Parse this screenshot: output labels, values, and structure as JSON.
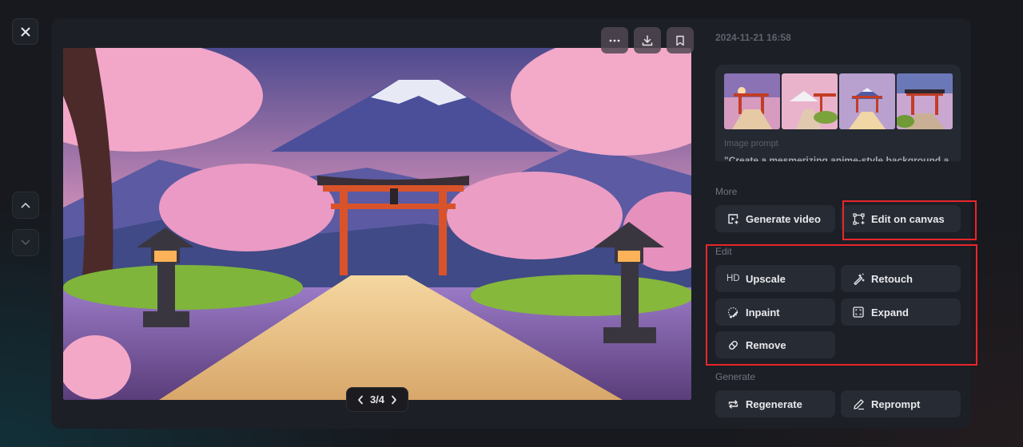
{
  "window": {
    "close_icon": "close-icon",
    "nav": {
      "up_icon": "chevron-up-icon",
      "down_icon": "chevron-down-icon"
    }
  },
  "image_toolbar": {
    "more_icon": "ellipsis-icon",
    "download_icon": "download-icon",
    "bookmark_icon": "bookmark-icon"
  },
  "pager": {
    "current": 3,
    "total": 4,
    "label": "3/4"
  },
  "details": {
    "timestamp": "2024-11-21 16:58",
    "prompt_label": "Image prompt",
    "prompt_text": "\"Create a mesmerizing anime-style background a",
    "thumbnails": [
      {
        "name": "variation-1",
        "selected": false
      },
      {
        "name": "variation-2",
        "selected": false
      },
      {
        "name": "variation-3",
        "selected": true
      },
      {
        "name": "variation-4",
        "selected": false
      }
    ]
  },
  "sections": {
    "more": {
      "label": "More",
      "buttons": [
        {
          "label": "Generate video",
          "icon": "video-plus-icon"
        },
        {
          "label": "Edit on canvas",
          "icon": "canvas-select-icon"
        }
      ]
    },
    "edit": {
      "label": "Edit",
      "buttons": [
        {
          "label": "Upscale",
          "icon": "hd-icon",
          "icon_text": "HD"
        },
        {
          "label": "Retouch",
          "icon": "magic-wand-icon"
        },
        {
          "label": "Inpaint",
          "icon": "brush-lasso-icon"
        },
        {
          "label": "Expand",
          "icon": "expand-frame-icon"
        },
        {
          "label": "Remove",
          "icon": "eraser-icon"
        }
      ]
    },
    "generate": {
      "label": "Generate",
      "buttons": [
        {
          "label": "Regenerate",
          "icon": "repeat-icon"
        },
        {
          "label": "Reprompt",
          "icon": "pencil-icon"
        }
      ]
    }
  },
  "highlight_color": "#e8262a"
}
